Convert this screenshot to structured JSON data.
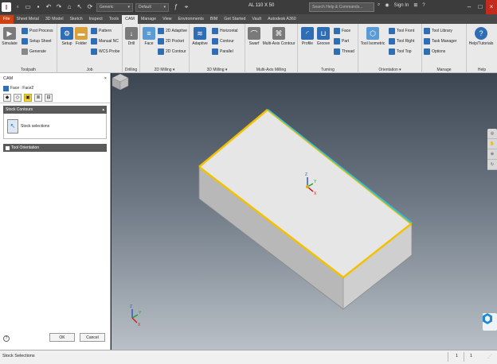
{
  "titlebar": {
    "app_letter": "I",
    "combo_material": "Generic",
    "combo_appearance": "Default",
    "document_title": "AL 110 X 50",
    "search_placeholder": "Search Help & Commands...",
    "sign_in": "Sign In",
    "help": "?"
  },
  "tabs": [
    "File",
    "Sheet Metal",
    "3D Model",
    "Sketch",
    "Inspect",
    "Tools",
    "CAM",
    "Manage",
    "View",
    "Environments",
    "BIM",
    "Get Started",
    "Vault",
    "Autodesk A360"
  ],
  "active_tab": "CAM",
  "ribbon": {
    "toolpath": {
      "title": "Toolpath",
      "simulate": "Simulate",
      "post_process": "Post Process",
      "setup_sheet": "Setup Sheet",
      "generate": "Generate"
    },
    "job": {
      "title": "Job",
      "setup": "Setup",
      "folder": "Folder",
      "pattern": "Pattern",
      "manual_nc": "Manual NC",
      "wcs_probe": "WCS Probe"
    },
    "drilling": {
      "title": "Drilling",
      "drill": "Drill"
    },
    "milling2d": {
      "title": "2D Milling",
      "face": "Face",
      "adaptive_2d": "2D Adaptive",
      "pocket_2d": "2D Pocket",
      "contour_2d": "2D Contour"
    },
    "milling3d": {
      "title": "3D Milling",
      "adaptive": "Adaptive",
      "horizontal": "Horizontal",
      "contour": "Contour",
      "parallel": "Parallel"
    },
    "multiaxis": {
      "title": "Multi-Axis Milling",
      "swarf": "Swarf",
      "multi_axis_contour": "Multi-Axis Contour"
    },
    "turning": {
      "title": "Turning",
      "profile": "Profile",
      "groove": "Groove",
      "face": "Face",
      "part": "Part",
      "thread": "Thread"
    },
    "orientation": {
      "title": "Orientation",
      "tool_isometric": "Tool Isometric",
      "tool_front": "Tool Front",
      "tool_right": "Tool Right",
      "tool_top": "Tool Top"
    },
    "manage": {
      "title": "Manage",
      "tool_library": "Tool Library",
      "task_manager": "Task Manager",
      "options": "Options"
    },
    "help": {
      "title": "Help",
      "help_tutorials": "Help/Tutorials"
    }
  },
  "browser": {
    "header": "CAM",
    "face_label": "Face : Face2",
    "stock_group_title": "Stock Contours",
    "stock_selections": "Stock selections",
    "orientation_group_title": "Tool Orientation",
    "ok": "OK",
    "cancel": "Cancel",
    "help": "?"
  },
  "viewport": {
    "axis_z": "Z",
    "axis_y": "Y",
    "axis_x": "X",
    "model_color": "#e6e6e6",
    "selected_edge_color": "#f2c200",
    "highlight_edge_color": "#35c4d6"
  },
  "status": {
    "message": "Stock Selections",
    "num1": "1",
    "num2": "1"
  }
}
